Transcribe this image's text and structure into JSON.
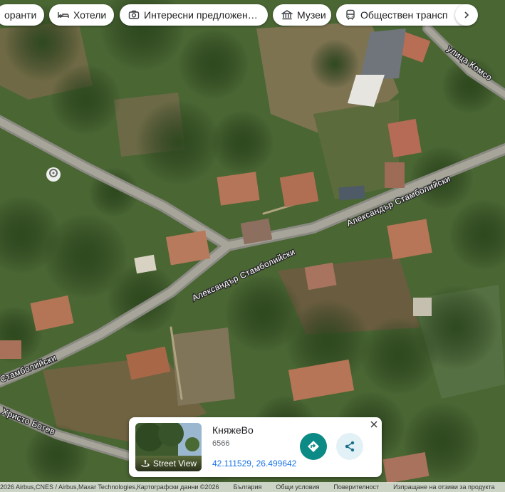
{
  "chips": [
    {
      "label": "оранти",
      "icon": "restaurant-icon"
    },
    {
      "label": "Хотели",
      "icon": "hotel-icon"
    },
    {
      "label": "Интересни предложен…",
      "icon": "camera-icon"
    },
    {
      "label": "Музеи",
      "icon": "museum-icon"
    },
    {
      "label": "Обществен трансп",
      "icon": "transit-icon"
    }
  ],
  "roads": {
    "main_1": "Александър Стамболийски",
    "main_2": "Александър Стамболийски",
    "main_3": "Стамболийски",
    "botev": "Христо Ботев",
    "komsomol": "улица Комсо"
  },
  "place_card": {
    "name": "КняжеВо",
    "postal_code": "6566",
    "coordinates": "42.111529, 26.499642",
    "street_view_label": "Street View"
  },
  "attribution": {
    "imagery": "2026 Airbus,CNES / Airbus,Maxar Technologies,Картографски данни ©2026",
    "country": "България",
    "terms": "Общи условия",
    "privacy": "Поверителност",
    "feedback": "Изпращане на отзиви за продукта"
  }
}
